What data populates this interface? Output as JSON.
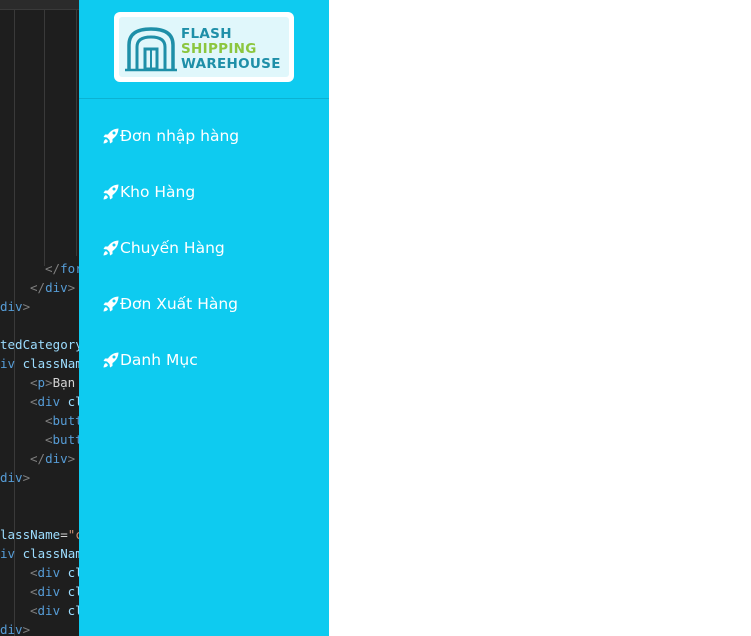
{
  "editor": {
    "lines": [
      {
        "indent": 3,
        "parts": [
          {
            "t": "tag",
            "v": "</"
          },
          {
            "t": "name",
            "v": "form"
          },
          {
            "t": "tag",
            "v": ">"
          }
        ]
      },
      {
        "indent": 2,
        "parts": [
          {
            "t": "tag",
            "v": "</"
          },
          {
            "t": "name",
            "v": "div"
          },
          {
            "t": "tag",
            "v": ">"
          }
        ]
      },
      {
        "indent": 0,
        "parts": [
          {
            "t": "name",
            "v": "div"
          },
          {
            "t": "tag",
            "v": ">"
          }
        ]
      },
      {
        "indent": 0,
        "parts": []
      },
      {
        "indent": 0,
        "parts": [
          {
            "t": "attr",
            "v": "tedCategory"
          }
        ]
      },
      {
        "indent": 0,
        "parts": [
          {
            "t": "name",
            "v": "iv "
          },
          {
            "t": "attr",
            "v": "classNam"
          }
        ]
      },
      {
        "indent": 2,
        "parts": [
          {
            "t": "tag",
            "v": "<"
          },
          {
            "t": "name",
            "v": "p"
          },
          {
            "t": "tag",
            "v": ">"
          },
          {
            "t": "text",
            "v": "Bạn c"
          }
        ]
      },
      {
        "indent": 2,
        "parts": [
          {
            "t": "tag",
            "v": "<"
          },
          {
            "t": "name",
            "v": "div"
          },
          {
            "t": "attr",
            "v": " clas"
          }
        ]
      },
      {
        "indent": 3,
        "parts": [
          {
            "t": "tag",
            "v": "<"
          },
          {
            "t": "name",
            "v": "butt"
          }
        ]
      },
      {
        "indent": 3,
        "parts": [
          {
            "t": "tag",
            "v": "<"
          },
          {
            "t": "name",
            "v": "butt"
          }
        ]
      },
      {
        "indent": 2,
        "parts": [
          {
            "t": "tag",
            "v": "</"
          },
          {
            "t": "name",
            "v": "div"
          },
          {
            "t": "tag",
            "v": ">"
          }
        ]
      },
      {
        "indent": 0,
        "parts": [
          {
            "t": "name",
            "v": "div"
          },
          {
            "t": "tag",
            "v": ">"
          }
        ]
      },
      {
        "indent": 0,
        "parts": []
      },
      {
        "indent": 0,
        "parts": []
      },
      {
        "indent": 0,
        "parts": [
          {
            "t": "attr",
            "v": "lassName"
          },
          {
            "t": "text",
            "v": "="
          },
          {
            "t": "str",
            "v": "\"c"
          }
        ]
      },
      {
        "indent": 0,
        "parts": [
          {
            "t": "name",
            "v": "iv "
          },
          {
            "t": "attr",
            "v": "classNam"
          }
        ]
      },
      {
        "indent": 2,
        "parts": [
          {
            "t": "tag",
            "v": "<"
          },
          {
            "t": "name",
            "v": "div"
          },
          {
            "t": "attr",
            "v": " clas"
          }
        ]
      },
      {
        "indent": 2,
        "parts": [
          {
            "t": "tag",
            "v": "<"
          },
          {
            "t": "name",
            "v": "div"
          },
          {
            "t": "attr",
            "v": " clas"
          }
        ]
      },
      {
        "indent": 2,
        "parts": [
          {
            "t": "tag",
            "v": "<"
          },
          {
            "t": "name",
            "v": "div"
          },
          {
            "t": "attr",
            "v": " clas"
          }
        ]
      },
      {
        "indent": 0,
        "parts": [
          {
            "t": "name",
            "v": "div"
          },
          {
            "t": "tag",
            "v": ">"
          }
        ]
      }
    ]
  },
  "sidebar": {
    "background": "#0ecbf0",
    "logo": {
      "line1": "FLASH",
      "line2": "SHIPPING",
      "line3": "WAREHOUSE",
      "color_main": "#1e8fa8",
      "color_accent": "#8cc63f"
    },
    "items": [
      {
        "label": "Đơn nhập hàng",
        "icon": "rocket-icon"
      },
      {
        "label": "Kho Hàng",
        "icon": "rocket-icon"
      },
      {
        "label": "Chuyến Hàng",
        "icon": "rocket-icon"
      },
      {
        "label": "Đơn Xuất Hàng",
        "icon": "rocket-icon"
      },
      {
        "label": "Danh Mục",
        "icon": "rocket-icon"
      }
    ]
  }
}
